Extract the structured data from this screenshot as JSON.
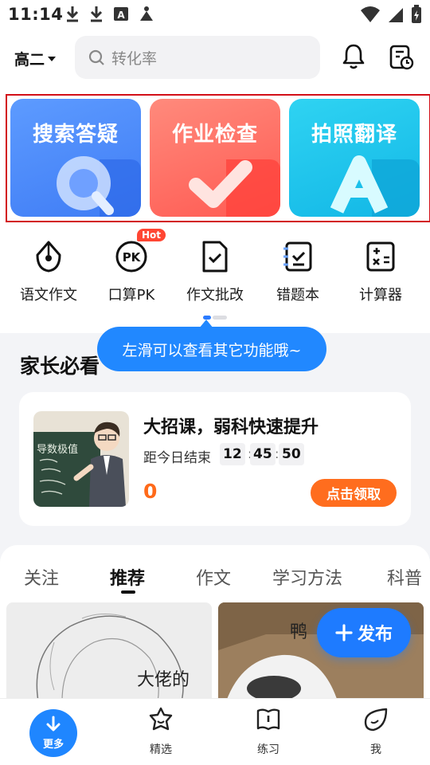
{
  "status_bar": {
    "time": "11:14"
  },
  "header": {
    "grade": "高二",
    "search_placeholder": "转化率"
  },
  "feature_cards": [
    {
      "label": "搜索答疑",
      "icon": "q-icon",
      "color": "#4d8cff"
    },
    {
      "label": "作业检查",
      "icon": "check-icon",
      "color": "#ff6b61"
    },
    {
      "label": "拍照翻译",
      "icon": "a-icon",
      "color": "#18c6ea"
    }
  ],
  "tools": [
    {
      "label": "语文作文",
      "icon": "pen-nib-icon"
    },
    {
      "label": "口算PK",
      "icon": "pk-icon",
      "badge": "Hot"
    },
    {
      "label": "作文批改",
      "icon": "doc-check-icon"
    },
    {
      "label": "错题本",
      "icon": "notebook-check-icon"
    },
    {
      "label": "计算器",
      "icon": "calculator-icon"
    }
  ],
  "tooltip": "左滑可以查看其它功能哦~",
  "parents_section": {
    "title": "家长必看",
    "promo": {
      "title": "大招课，弱科快速提升",
      "countdown_label": "距今日结束",
      "hours": "12",
      "minutes": "45",
      "seconds": "50",
      "price": "0",
      "button": "点击领取",
      "image_text": "导数极值"
    }
  },
  "feed": {
    "tabs": [
      "关注",
      "推荐",
      "作文",
      "学习方法",
      "科普"
    ],
    "active_tab": "推荐",
    "thumb1_caption": "大佬的",
    "thumb2_caption": "鸭"
  },
  "publish_button": "发布",
  "bottom_nav": [
    {
      "label": "更多",
      "icon": "download-arrow-icon"
    },
    {
      "label": "精选",
      "icon": "star-face-icon"
    },
    {
      "label": "练习",
      "icon": "book-icon"
    },
    {
      "label": "我",
      "icon": "leaf-icon"
    }
  ],
  "colors": {
    "accent": "#1f86ff",
    "orange": "#ff6d1e",
    "highlight_frame": "#d20f18"
  }
}
